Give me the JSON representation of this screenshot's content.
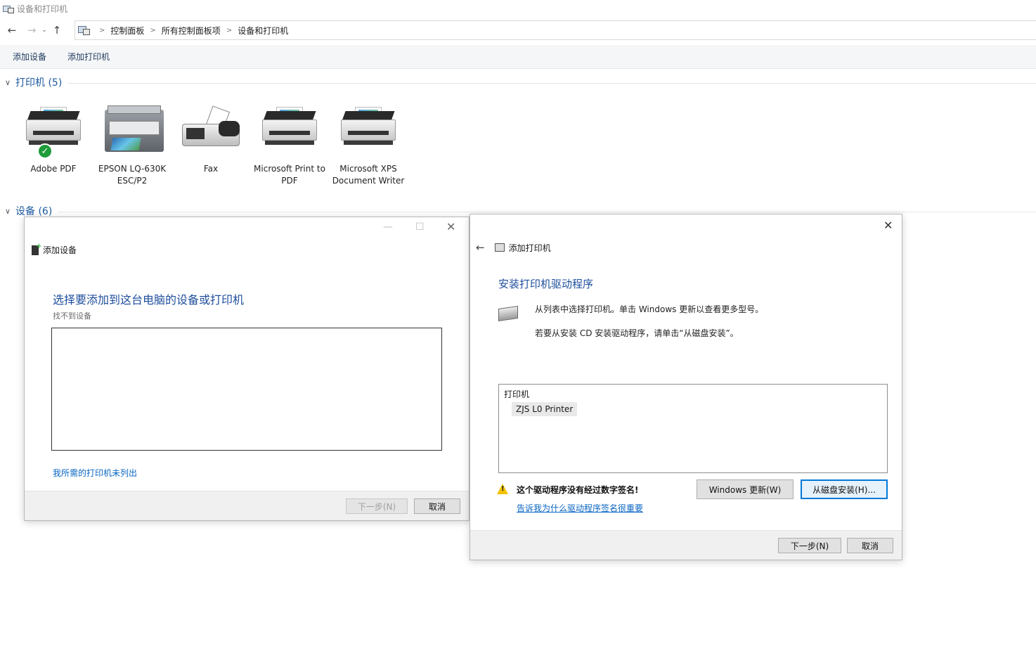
{
  "window": {
    "title": "设备和打印机"
  },
  "nav": {
    "back": "←",
    "forward": "→",
    "recent": "⌄",
    "up": "↑",
    "breadcrumb": [
      "控制面板",
      "所有控制面板项",
      "设备和打印机"
    ]
  },
  "commands": {
    "add_device": "添加设备",
    "add_printer": "添加打印机"
  },
  "groups": {
    "printers": {
      "title": "打印机 (5)"
    },
    "devices": {
      "title": "设备 (6)"
    }
  },
  "printers": [
    {
      "name": "Adobe PDF",
      "icon": "printer-icon",
      "default": true
    },
    {
      "name": "EPSON LQ-630K ESC/P2",
      "icon": "multifunction-printer-icon",
      "default": false
    },
    {
      "name": "Fax",
      "icon": "fax-icon",
      "default": false
    },
    {
      "name": "Microsoft Print to PDF",
      "icon": "printer-icon",
      "default": false
    },
    {
      "name": "Microsoft XPS Document Writer",
      "icon": "printer-icon",
      "default": false
    }
  ],
  "add_device_dialog": {
    "title": "添加设备",
    "heading": "选择要添加到这台电脑的设备或打印机",
    "status": "找不到设备",
    "link": "我所需的打印机未列出",
    "next": "下一步(N)",
    "cancel": "取消"
  },
  "add_printer_dialog": {
    "title": "添加打印机",
    "heading": "安装打印机驱动程序",
    "desc1": "从列表中选择打印机。单击 Windows 更新以查看更多型号。",
    "desc2": "若要从安装 CD 安装驱动程序，请单击“从磁盘安装”。",
    "list_header": "打印机",
    "list_items": [
      "ZJS L0 Printer"
    ],
    "warning": "这个驱动程序没有经过数字签名!",
    "warning_link": "告诉我为什么驱动程序签名很重要",
    "windows_update": "Windows 更新(W)",
    "have_disk": "从磁盘安装(H)...",
    "next": "下一步(N)",
    "cancel": "取消"
  },
  "colors": {
    "accent": "#0078d7",
    "heading_blue": "#1e5aa0",
    "link": "#0a66c2",
    "default_badge": "#1e9b3a"
  }
}
